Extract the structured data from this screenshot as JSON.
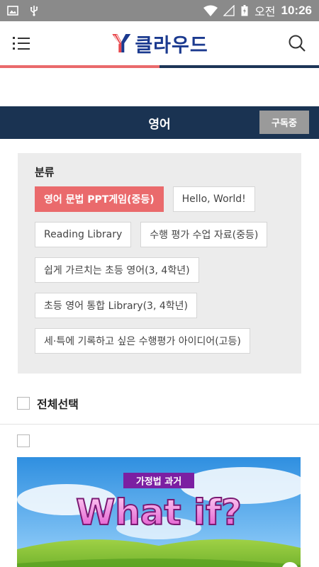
{
  "status_bar": {
    "ampm": "오전",
    "time": "10:26"
  },
  "header": {
    "logo_text": "클라우드"
  },
  "category": {
    "title": "영어",
    "subscribe_label": "구독중"
  },
  "filter": {
    "label": "분류",
    "tags": [
      {
        "label": "영어 문법 PPT게임(중등)",
        "active": true
      },
      {
        "label": "Hello, World!",
        "active": false
      },
      {
        "label": "Reading Library",
        "active": false
      },
      {
        "label": "수행 평가 수업 자료(중등)",
        "active": false
      },
      {
        "label": "쉽게 가르치는 초등 영어(3, 4학년)",
        "active": false
      },
      {
        "label": "초등 영어 통합 Library(3, 4학년)",
        "active": false
      },
      {
        "label": "세·특에 기록하고 싶은 수행평가 아이디어(고등)",
        "active": false
      }
    ]
  },
  "list": {
    "select_all_label": "전체선택",
    "items": [
      {
        "subtitle": "가정법 과거",
        "title": "What if?"
      }
    ]
  },
  "colors": {
    "accent_red": "#ea6a6c",
    "navy": "#1a3352",
    "logo_blue": "#1b3a8f"
  }
}
